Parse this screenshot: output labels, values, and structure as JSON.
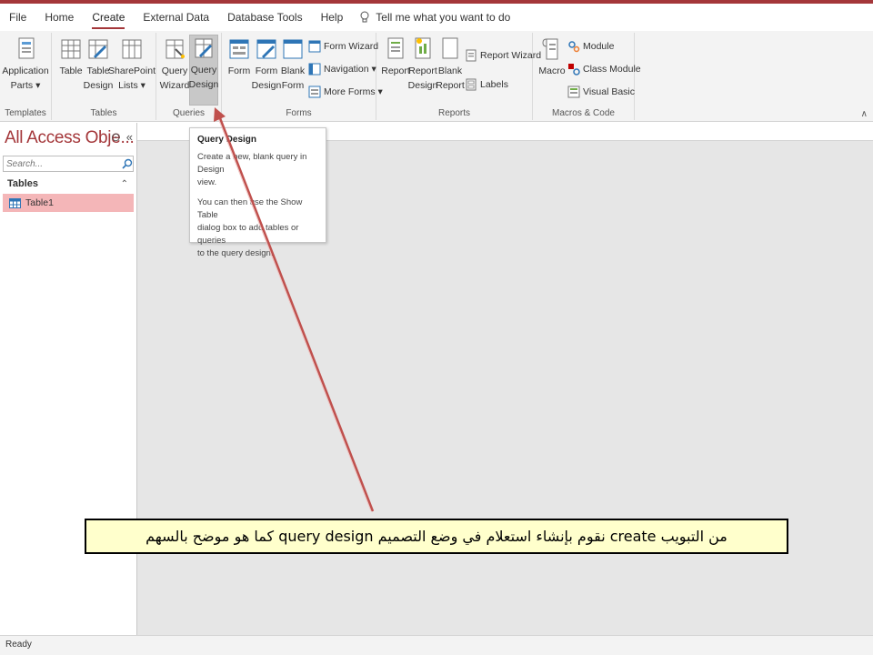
{
  "menu": {
    "tabs": [
      "File",
      "Home",
      "Create",
      "External Data",
      "Database Tools",
      "Help"
    ],
    "active_tab": "Create",
    "tell_me": "Tell me what you want to do"
  },
  "ribbon": {
    "templates": {
      "label": "Templates",
      "application_parts": [
        "Application",
        "Parts ▾"
      ]
    },
    "tables": {
      "label": "Tables",
      "table": "Table",
      "table_design": [
        "Table",
        "Design"
      ],
      "sharepoint_lists": [
        "SharePoint",
        "Lists ▾"
      ]
    },
    "queries": {
      "label": "Queries",
      "query_wizard": [
        "Query",
        "Wizard"
      ],
      "query_design": [
        "Query",
        "Design"
      ]
    },
    "forms": {
      "label": "Forms",
      "form": "Form",
      "form_design": [
        "Form",
        "Design"
      ],
      "blank_form": [
        "Blank",
        "Form"
      ],
      "form_wizard": "Form Wizard",
      "navigation": "Navigation ▾",
      "more_forms": "More Forms ▾"
    },
    "reports": {
      "label": "Reports",
      "report": "Report",
      "report_design": [
        "Report",
        "Design"
      ],
      "blank_report": [
        "Blank",
        "Report"
      ],
      "report_wizard": "Report Wizard",
      "labels": "Labels"
    },
    "macros": {
      "label": "Macros & Code",
      "macro": "Macro",
      "module": "Module",
      "class_module": "Class Module",
      "visual_basic": "Visual Basic"
    }
  },
  "nav_pane": {
    "title": "All Access Obje...",
    "search_placeholder": "Search...",
    "section": "Tables",
    "items": [
      "Table1"
    ]
  },
  "tooltip": {
    "title": "Query Design",
    "lines_1": [
      "Create a new, blank query in Design",
      "view."
    ],
    "lines_2": [
      "You can then use the Show Table",
      "dialog box to add tables or queries",
      "to the query design."
    ]
  },
  "status": "Ready",
  "callout": "من التبويب create نقوم بإنشاء استعلام في وضع التصميم query design كما هو موضح بالسهم",
  "colors": {
    "accent": "#a4373a",
    "selected_row": "#f4b6b8",
    "arrow": "#c0504d",
    "callout_bg": "#ffffcc"
  }
}
